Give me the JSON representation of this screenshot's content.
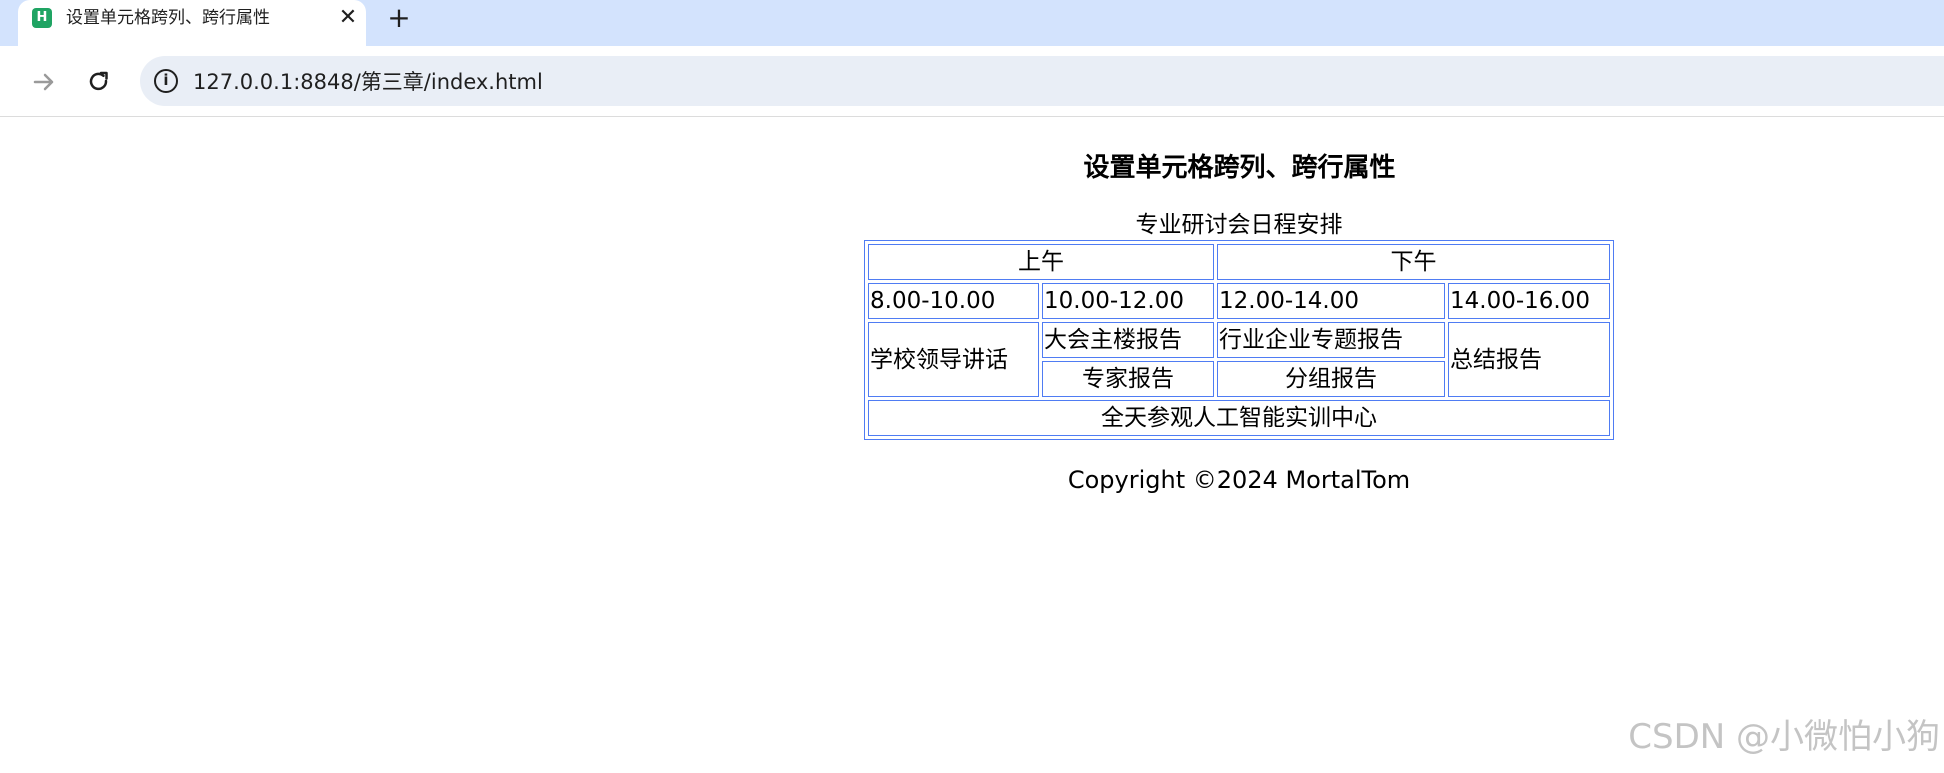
{
  "browser": {
    "tab_title": "设置单元格跨列、跨行属性",
    "tab_close_symbol": "✕",
    "new_tab_symbol": "+",
    "url": "127.0.0.1:8848/第三章/index.html",
    "icons": {
      "favicon": "hbuilder-h-icon",
      "forward": "forward-arrow-icon",
      "reload": "reload-icon",
      "site_info": "info-circle-icon"
    }
  },
  "page": {
    "heading": "设置单元格跨列、跨行属性",
    "table": {
      "caption": "专业研讨会日程安排",
      "border_color": "#4f7cf3",
      "rows": {
        "header": {
          "morning": "上午",
          "afternoon": "下午"
        },
        "times": [
          "8.00-10.00",
          "10.00-12.00",
          "12.00-14.00",
          "14.00-16.00"
        ],
        "row3": {
          "leader_speech": "学校领导讲话",
          "main_report": "大会主楼报告",
          "industry_report": "行业企业专题报告",
          "summary_report": "总结报告"
        },
        "row4": {
          "expert_report": "专家报告",
          "group_report": "分组报告"
        },
        "footer": "全天参观人工智能实训中心"
      }
    },
    "copyright": "Copyright ©2024 MortalTom"
  },
  "watermark": "CSDN @小微怕小狗"
}
